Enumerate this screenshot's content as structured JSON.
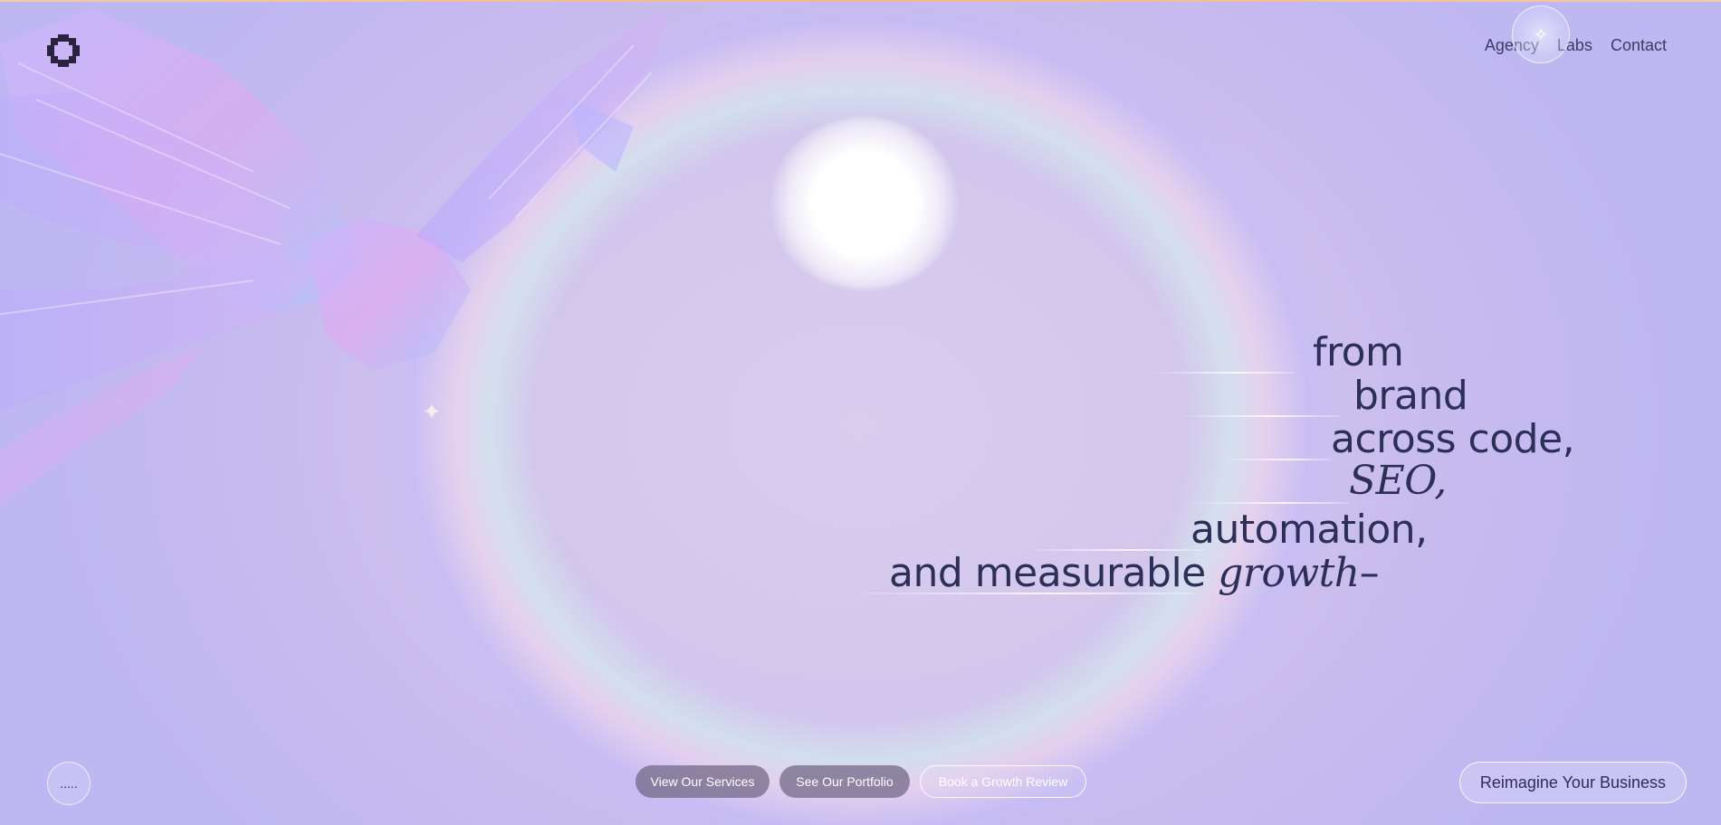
{
  "nav": {
    "items": [
      "Agency",
      "Labs",
      "Contact"
    ]
  },
  "headline": {
    "line1": "from",
    "line2": "brand",
    "line3": "across code,",
    "line4": "SEO,",
    "line5": "automation,",
    "line6_text": "and measurable",
    "line6_italic": "growth",
    "line6_dash": "–"
  },
  "buttons": {
    "services": "View Our Services",
    "portfolio": "See Our Portfolio",
    "review": "Book a Growth Review",
    "dots": ".....",
    "reimagine": "Reimagine Your Business"
  },
  "colors": {
    "text": "#2c2f57",
    "accent_line": "#f0b98a"
  },
  "icons": {
    "logo": "pixel-gear-logo",
    "cursor": "sparkle-cursor-orb"
  }
}
